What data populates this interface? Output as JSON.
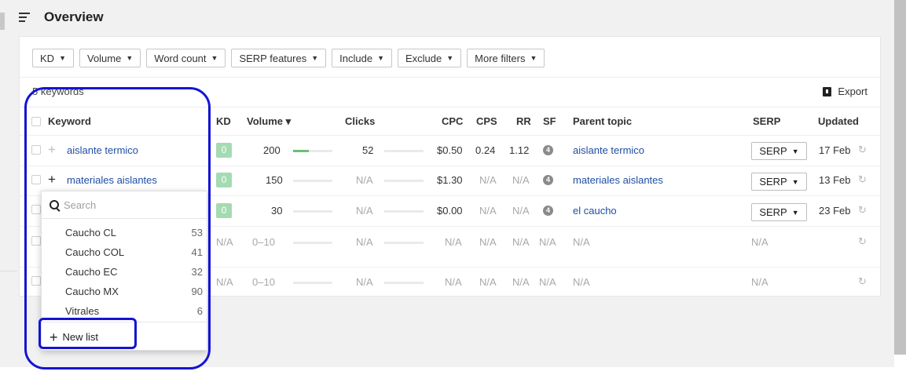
{
  "header": {
    "title": "Overview",
    "menu_icon": "hamburger-icon"
  },
  "filters": [
    {
      "label": "KD"
    },
    {
      "label": "Volume"
    },
    {
      "label": "Word count"
    },
    {
      "label": "SERP features"
    },
    {
      "label": "Include"
    },
    {
      "label": "Exclude"
    },
    {
      "label": "More filters"
    }
  ],
  "summary": {
    "keyword_count": "5 keywords",
    "export_label": "Export"
  },
  "columns": {
    "keyword": "Keyword",
    "kd": "KD",
    "volume": "Volume ▾",
    "clicks": "Clicks",
    "cpc": "CPC",
    "cps": "CPS",
    "rr": "RR",
    "sf": "SF",
    "parent_topic": "Parent topic",
    "serp": "SERP",
    "updated": "Updated"
  },
  "rows": [
    {
      "keyword": "aislante termico",
      "kd": "0",
      "volume": "200",
      "volume_fraction": 0.4,
      "clicks": "52",
      "cpc": "$0.50",
      "cps": "0.24",
      "rr": "1.12",
      "sf": "4",
      "parent_topic": "aislante termico",
      "serp": "SERP",
      "updated": "17 Feb"
    },
    {
      "keyword": "materiales aislantes",
      "kd": "0",
      "volume": "150",
      "volume_fraction": 0,
      "clicks": "N/A",
      "cpc": "$1.30",
      "cps": "N/A",
      "rr": "N/A",
      "sf": "4",
      "parent_topic": "materiales aislantes",
      "serp": "SERP",
      "updated": "13 Feb"
    },
    {
      "keyword": "",
      "kd": "0",
      "volume": "30",
      "volume_fraction": 0,
      "clicks": "N/A",
      "cpc": "$0.00",
      "cps": "N/A",
      "rr": "N/A",
      "sf": "4",
      "parent_topic": "el caucho",
      "serp": "SERP",
      "updated": "23 Feb"
    },
    {
      "keyword": "",
      "kd": "N/A",
      "volume": "0–10",
      "volume_fraction": 0,
      "clicks": "N/A",
      "cpc": "N/A",
      "cps": "N/A",
      "rr": "N/A",
      "sf": "N/A",
      "parent_topic": "N/A",
      "serp": "N/A",
      "updated": ""
    },
    {
      "keyword": "",
      "kd": "N/A",
      "volume": "0–10",
      "volume_fraction": 0,
      "clicks": "N/A",
      "cpc": "N/A",
      "cps": "N/A",
      "rr": "N/A",
      "sf": "N/A",
      "parent_topic": "N/A",
      "serp": "N/A",
      "updated": ""
    }
  ],
  "dropdown": {
    "search_placeholder": "Search",
    "lists": [
      {
        "name": "Caucho CL",
        "count": "53"
      },
      {
        "name": "Caucho COL",
        "count": "41"
      },
      {
        "name": "Caucho EC",
        "count": "32"
      },
      {
        "name": "Caucho MX",
        "count": "90"
      },
      {
        "name": "Vitrales",
        "count": "6"
      }
    ],
    "new_list_label": "New list"
  },
  "colors": {
    "link": "#1f4ea3",
    "kd_badge": "#a4dbb2",
    "highlight": "#1414d4",
    "volume_bar": "#6bbf73"
  }
}
